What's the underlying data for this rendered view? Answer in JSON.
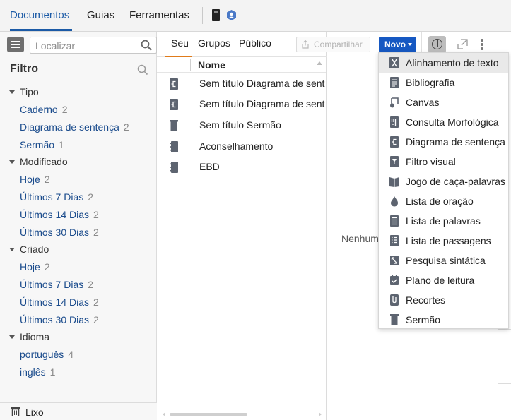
{
  "top_tabs": [
    {
      "label": "Documentos",
      "active": true
    },
    {
      "label": "Guias",
      "active": false
    },
    {
      "label": "Ferramentas",
      "active": false
    }
  ],
  "search": {
    "placeholder": "Localizar"
  },
  "filter": {
    "title": "Filtro",
    "groups": [
      {
        "label": "Tipo",
        "items": [
          {
            "label": "Caderno",
            "count": "2"
          },
          {
            "label": "Diagrama de sentença",
            "count": "2"
          },
          {
            "label": "Sermão",
            "count": "1"
          }
        ]
      },
      {
        "label": "Modificado",
        "items": [
          {
            "label": "Hoje",
            "count": "2"
          },
          {
            "label": "Últimos 7 Dias",
            "count": "2"
          },
          {
            "label": "Últimos 14 Dias",
            "count": "2"
          },
          {
            "label": "Últimos 30 Dias",
            "count": "2"
          }
        ]
      },
      {
        "label": "Criado",
        "items": [
          {
            "label": "Hoje",
            "count": "2"
          },
          {
            "label": "Últimos 7 Dias",
            "count": "2"
          },
          {
            "label": "Últimos 14 Dias",
            "count": "2"
          },
          {
            "label": "Últimos 30 Dias",
            "count": "2"
          }
        ]
      },
      {
        "label": "Idioma",
        "items": [
          {
            "label": "português",
            "count": "4"
          },
          {
            "label": "inglês",
            "count": "1"
          }
        ]
      }
    ],
    "trash_label": "Lixo"
  },
  "sub_tabs": [
    {
      "label": "Seu",
      "active": true
    },
    {
      "label": "Grupos",
      "active": false
    },
    {
      "label": "Público",
      "active": false
    }
  ],
  "document_list": {
    "column_header": "Nome",
    "rows": [
      {
        "name": "Sem título Diagrama de sentença",
        "icon": "sentence-diagram-icon"
      },
      {
        "name": "Sem título Diagrama de sentença",
        "icon": "sentence-diagram-icon"
      },
      {
        "name": "Sem título Sermão",
        "icon": "sermon-icon"
      },
      {
        "name": "Aconselhamento",
        "icon": "notebook-icon"
      },
      {
        "name": "EBD",
        "icon": "notebook-icon"
      }
    ]
  },
  "toolbar": {
    "share_label": "Compartilhar",
    "new_label": "Novo"
  },
  "empty_message": "Nenhum",
  "new_menu": [
    {
      "label": "Alinhamento de texto",
      "icon": "text-alignment-icon",
      "highlighted": true
    },
    {
      "label": "Bibliografia",
      "icon": "bibliography-icon"
    },
    {
      "label": "Canvas",
      "icon": "canvas-icon"
    },
    {
      "label": "Consulta Morfológica",
      "icon": "morph-query-icon"
    },
    {
      "label": "Diagrama de sentença",
      "icon": "sentence-diagram-icon"
    },
    {
      "label": "Filtro visual",
      "icon": "visual-filter-icon"
    },
    {
      "label": "Jogo de caça-palavras",
      "icon": "word-search-icon"
    },
    {
      "label": "Lista de oração",
      "icon": "prayer-list-icon"
    },
    {
      "label": "Lista de palavras",
      "icon": "word-list-icon"
    },
    {
      "label": "Lista de passagens",
      "icon": "passage-list-icon"
    },
    {
      "label": "Pesquisa sintática",
      "icon": "syntax-search-icon"
    },
    {
      "label": "Plano de leitura",
      "icon": "reading-plan-icon"
    },
    {
      "label": "Recortes",
      "icon": "clippings-icon"
    },
    {
      "label": "Sermão",
      "icon": "sermon-icon"
    }
  ],
  "colors": {
    "accent_blue": "#1b5aa6",
    "new_button": "#1658c2",
    "active_subtab": "#e07b1a",
    "link": "#1a4b8c"
  }
}
